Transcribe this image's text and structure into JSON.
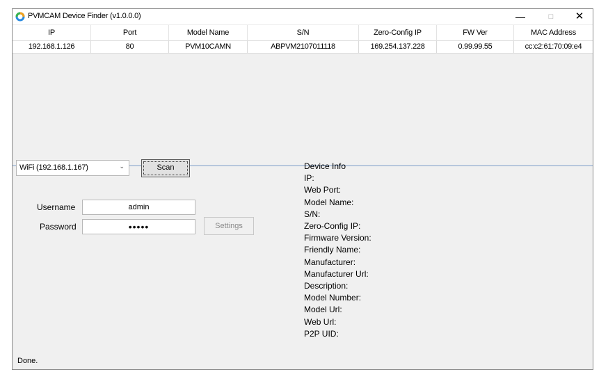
{
  "window": {
    "title": "PVMCAM Device Finder (v1.0.0.0)",
    "icon": "app-ring-icon",
    "controls": {
      "minimize": "—",
      "maximize": "□",
      "close": "✕"
    }
  },
  "device_list": {
    "columns": [
      "IP",
      "Port",
      "Model Name",
      "S/N",
      "Zero-Config IP",
      "FW Ver",
      "MAC Address"
    ],
    "rows": [
      [
        "192.168.1.126",
        "80",
        "PVM10CAMN",
        "ABPVM2107011118",
        "169.254.137.228",
        "0.99.99.55",
        "cc:c2:61:70:09:e4"
      ]
    ]
  },
  "network": {
    "selected": "WiFi (192.168.1.167)"
  },
  "scan_button": "Scan",
  "settings_button": "Settings",
  "credentials": {
    "username_label": "Username",
    "username_value": "admin",
    "password_label": "Password",
    "password_value": "•••••"
  },
  "device_info": {
    "heading": "Device Info",
    "fields": [
      "IP:",
      "Web Port:",
      "Model Name:",
      "S/N:",
      "Zero-Config IP:",
      "Firmware Version:",
      "Friendly Name:",
      "Manufacturer:",
      "Manufacturer Url:",
      "Description:",
      "Model Number:",
      "Model Url:",
      "Web Url:",
      "P2P UID:"
    ]
  },
  "status": "Done.",
  "colors": {
    "accent_border": "#7a9cc8",
    "window_bg": "#f0f0f0"
  }
}
